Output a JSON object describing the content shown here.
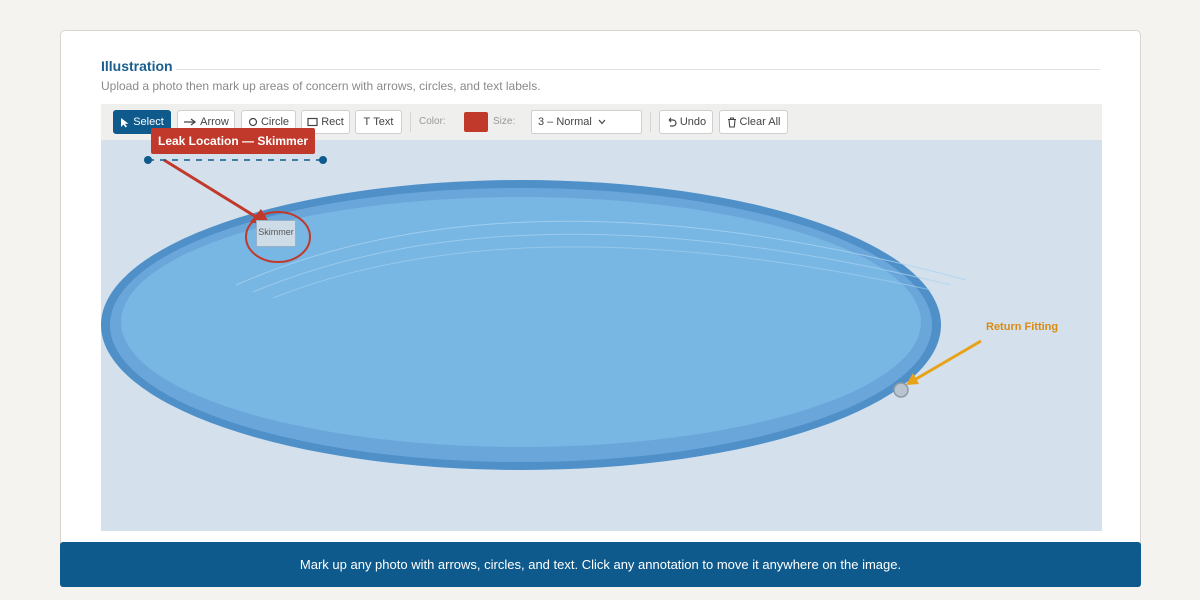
{
  "section": {
    "title": "Illustration",
    "subtitle": "Upload a photo then mark up areas of concern with arrows, circles, and text labels."
  },
  "toolbar": {
    "tools": [
      {
        "icon": "select-icon",
        "label": "Select",
        "active": true
      },
      {
        "icon": "arrow-icon",
        "label": "Arrow"
      },
      {
        "icon": "circle-icon",
        "label": "Circle"
      },
      {
        "icon": "rect-icon",
        "label": "Rect"
      },
      {
        "icon": "text-icon",
        "label": "Text"
      }
    ],
    "text_glyph": "T",
    "color_label": "Color:",
    "color_value": "#c0392b",
    "size_label": "Size:",
    "size_value": "3 – Normal",
    "undo_label": "Undo",
    "clear_label": "Clear All"
  },
  "annotations": {
    "label_text": "Leak Location — Skimmer",
    "label_color": "#c0392b",
    "skimmer_text": "Skimmer",
    "return_text": "Return Fitting",
    "return_color": "#e8a218"
  },
  "footer": {
    "text": "Mark up any photo with arrows, circles, and text. Click any annotation to move it anywhere on the image."
  }
}
